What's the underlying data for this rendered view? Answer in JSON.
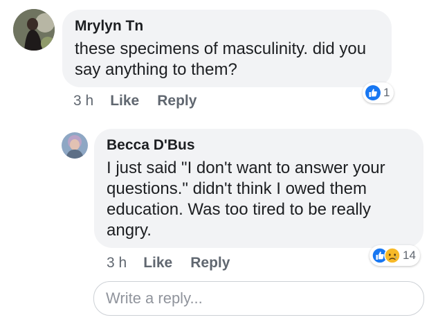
{
  "comments": [
    {
      "author": "Mrylyn Tn",
      "text": "these specimens of masculinity. did you say anything to them?",
      "time": "3 h",
      "like_label": "Like",
      "reply_label": "Reply",
      "reaction_count": "1",
      "reaction_icons": [
        "like-icon"
      ]
    },
    {
      "author": "Becca D'Bus",
      "text": "I just said \"I don't want to answer your questions.\" didn't think I owed them education. Was too tired to be really angry.",
      "time": "3 h",
      "like_label": "Like",
      "reply_label": "Reply",
      "reaction_count": "14",
      "reaction_icons": [
        "like-icon",
        "sad-icon"
      ]
    }
  ],
  "reply_box": {
    "placeholder": "Write a reply..."
  },
  "colors": {
    "bubble": "#f2f3f5",
    "like_blue": "#1877f2",
    "sad_yellow": "#f7b928",
    "meta_gray": "#606770"
  }
}
